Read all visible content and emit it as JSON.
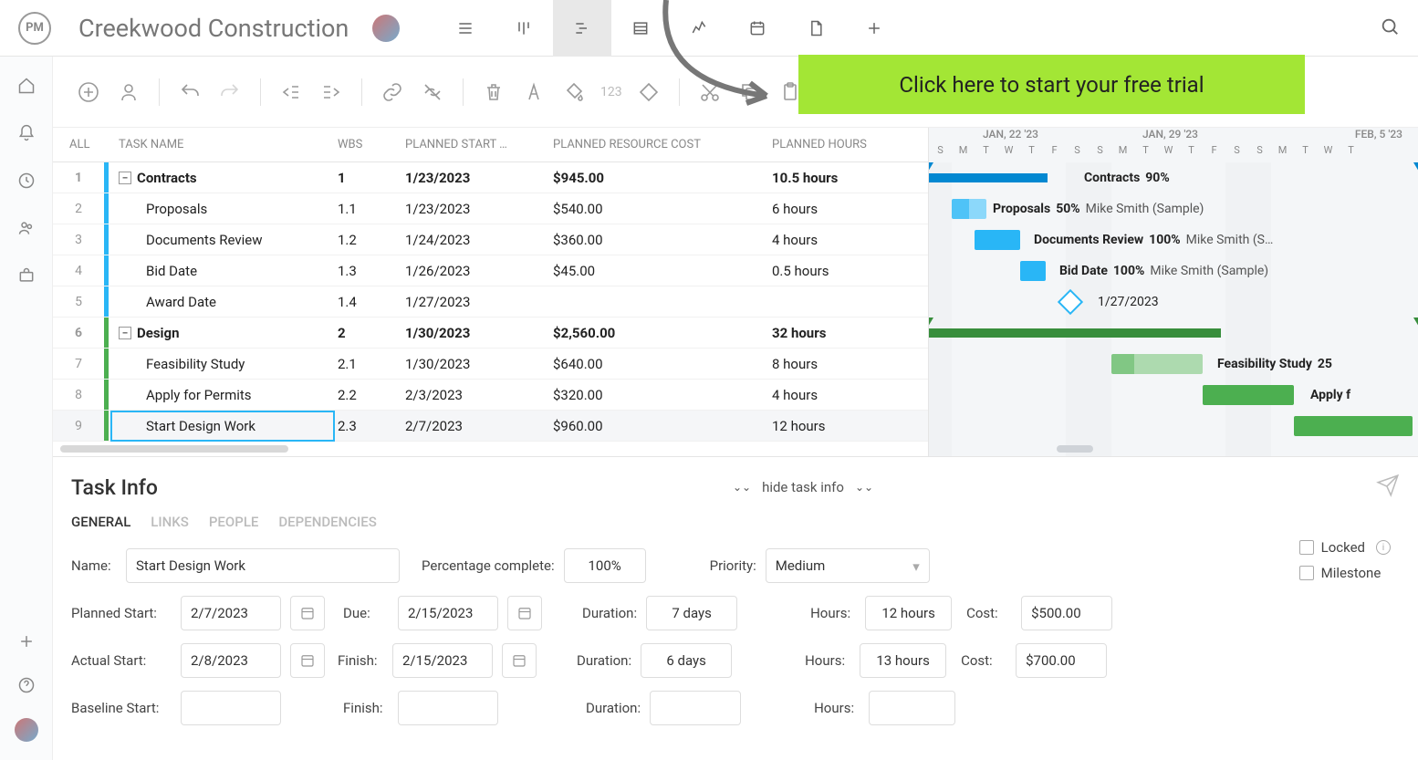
{
  "header": {
    "logo": "PM",
    "project_title": "Creekwood Construction"
  },
  "cta": {
    "text": "Click here to start your free trial"
  },
  "table": {
    "headers": {
      "all": "ALL",
      "name": "TASK NAME",
      "wbs": "WBS",
      "start": "PLANNED START …",
      "cost": "PLANNED RESOURCE COST",
      "hours": "PLANNED HOURS"
    },
    "rows": [
      {
        "n": "1",
        "name": "Contracts",
        "wbs": "1",
        "start": "1/23/2023",
        "cost": "$945.00",
        "hours": "10.5 hours",
        "parent": true,
        "color": "blue"
      },
      {
        "n": "2",
        "name": "Proposals",
        "wbs": "1.1",
        "start": "1/23/2023",
        "cost": "$540.00",
        "hours": "6 hours",
        "color": "blue"
      },
      {
        "n": "3",
        "name": "Documents Review",
        "wbs": "1.2",
        "start": "1/24/2023",
        "cost": "$360.00",
        "hours": "4 hours",
        "color": "blue"
      },
      {
        "n": "4",
        "name": "Bid Date",
        "wbs": "1.3",
        "start": "1/26/2023",
        "cost": "$45.00",
        "hours": "0.5 hours",
        "color": "blue"
      },
      {
        "n": "5",
        "name": "Award Date",
        "wbs": "1.4",
        "start": "1/27/2023",
        "cost": "",
        "hours": "",
        "color": "blue"
      },
      {
        "n": "6",
        "name": "Design",
        "wbs": "2",
        "start": "1/30/2023",
        "cost": "$2,560.00",
        "hours": "32 hours",
        "parent": true,
        "color": "green"
      },
      {
        "n": "7",
        "name": "Feasibility Study",
        "wbs": "2.1",
        "start": "1/30/2023",
        "cost": "$640.00",
        "hours": "8 hours",
        "color": "green"
      },
      {
        "n": "8",
        "name": "Apply for Permits",
        "wbs": "2.2",
        "start": "2/3/2023",
        "cost": "$320.00",
        "hours": "4 hours",
        "color": "green"
      },
      {
        "n": "9",
        "name": "Start Design Work",
        "wbs": "2.3",
        "start": "2/7/2023",
        "cost": "$960.00",
        "hours": "12 hours",
        "color": "green",
        "selected": true
      }
    ]
  },
  "gantt": {
    "weeks": [
      "JAN, 22 '23",
      "JAN, 29 '23",
      "FEB, 5 '23"
    ],
    "days": [
      "S",
      "M",
      "T",
      "W",
      "T",
      "F",
      "S",
      "S",
      "M",
      "T",
      "W",
      "T",
      "F",
      "S",
      "S",
      "M",
      "T",
      "W",
      "T"
    ],
    "bars": [
      {
        "label": "Contracts",
        "pct": "90%",
        "assignee": ""
      },
      {
        "label": "Proposals",
        "pct": "50%",
        "assignee": "Mike Smith (Sample)"
      },
      {
        "label": "Documents Review",
        "pct": "100%",
        "assignee": "Mike Smith (S…"
      },
      {
        "label": "Bid Date",
        "pct": "100%",
        "assignee": "Mike Smith (Sample)"
      },
      {
        "label": "",
        "pct": "",
        "assignee": "1/27/2023"
      },
      {
        "label": "",
        "pct": "",
        "assignee": ""
      },
      {
        "label": "Feasibility Study",
        "pct": "25",
        "assignee": ""
      },
      {
        "label": "Apply f",
        "pct": "",
        "assignee": ""
      }
    ]
  },
  "details": {
    "title": "Task Info",
    "hide": "hide task info",
    "tabs": {
      "general": "GENERAL",
      "links": "LINKS",
      "people": "PEOPLE",
      "deps": "DEPENDENCIES"
    },
    "labels": {
      "name": "Name:",
      "pct": "Percentage complete:",
      "priority": "Priority:",
      "pstart": "Planned Start:",
      "due": "Due:",
      "duration": "Duration:",
      "hours": "Hours:",
      "cost": "Cost:",
      "astart": "Actual Start:",
      "finish": "Finish:",
      "bstart": "Baseline Start:",
      "locked": "Locked",
      "milestone": "Milestone"
    },
    "values": {
      "name": "Start Design Work",
      "pct": "100%",
      "priority": "Medium",
      "pstart": "2/7/2023",
      "due": "2/15/2023",
      "pduration": "7 days",
      "phours": "12 hours",
      "pcost": "$500.00",
      "astart": "2/8/2023",
      "finish": "2/15/2023",
      "aduration": "6 days",
      "ahours": "13 hours",
      "acost": "$700.00",
      "bstart": "",
      "bfinish": "",
      "bduration": "",
      "bhours": ""
    }
  },
  "toolbar": {
    "num": "123"
  }
}
